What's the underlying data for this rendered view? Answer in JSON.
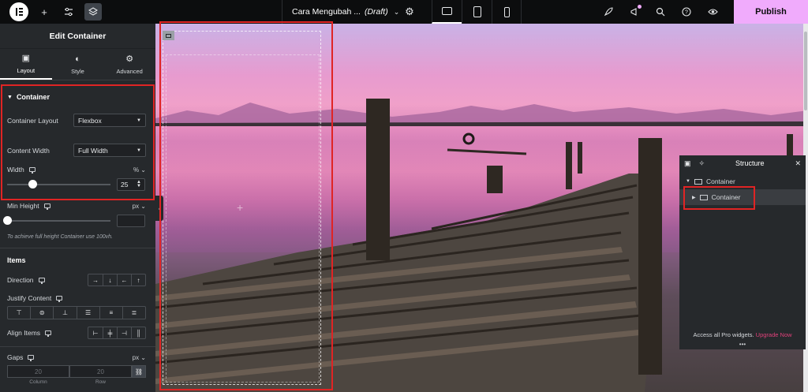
{
  "topbar": {
    "doc_name": "Cara Mengubah ...",
    "doc_status": "(Draft)",
    "publish_label": "Publish"
  },
  "panel": {
    "title": "Edit Container",
    "tabs": [
      {
        "label": "Layout",
        "icon": "layout-icon"
      },
      {
        "label": "Style",
        "icon": "style-icon"
      },
      {
        "label": "Advanced",
        "icon": "gear-icon"
      }
    ],
    "container_section": "Container",
    "container_layout_label": "Container Layout",
    "container_layout_value": "Flexbox",
    "content_width_label": "Content Width",
    "content_width_value": "Full Width",
    "width_label": "Width",
    "width_unit": "% ⌄",
    "width_value": "25",
    "width_fraction": 0.25,
    "min_height_label": "Min Height",
    "min_height_unit": "px ⌄",
    "min_height_hint": "To achieve full height Container use 100vh.",
    "items_section": "Items",
    "direction_label": "Direction",
    "justify_label": "Justify Content",
    "align_label": "Align Items",
    "gaps_label": "Gaps",
    "gaps_unit": "px ⌄",
    "gap_column": "20",
    "gap_row": "20",
    "gap_column_label": "Column",
    "gap_row_label": "Row"
  },
  "structure": {
    "title": "Structure",
    "items": [
      {
        "label": "Container"
      },
      {
        "label": "Container"
      }
    ],
    "footer_text": "Access all Pro widgets.",
    "footer_link": "Upgrade Now",
    "dots": "•••"
  }
}
